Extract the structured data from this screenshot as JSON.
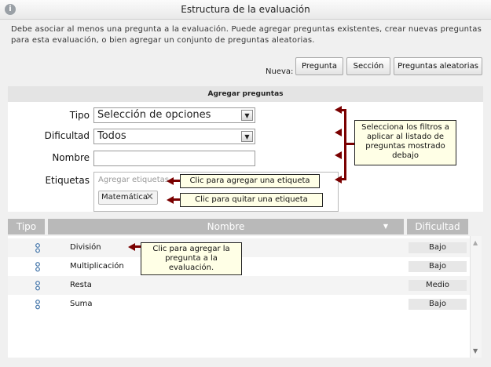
{
  "window": {
    "title": "Estructura de la evaluación",
    "info_icon": "info-icon"
  },
  "intro": "Debe asociar al menos una pregunta a la evaluación. Puede agregar preguntas existentes, crear nuevas preguntas para esta evaluación, o bien agregar un conjunto de preguntas aleatorias.",
  "toolbar": {
    "nueva_label": "Nueva:",
    "pregunta": "Pregunta",
    "seccion": "Sección",
    "aleatorias": "Preguntas aleatorias"
  },
  "panel": {
    "title": "Agregar preguntas",
    "tipo_label": "Tipo",
    "tipo_value": "Selección de opciones",
    "dificultad_label": "Dificultad",
    "dificultad_value": "Todos",
    "nombre_label": "Nombre",
    "nombre_value": "",
    "etiquetas_label": "Etiquetas",
    "etiquetas_placeholder": "Agregar etiquetas",
    "chip": "Matemática"
  },
  "callouts": {
    "filters": "Selecciona los filtros a aplicar al listado de preguntas mostrado debajo",
    "add_tag": "Clic para agregar una etiqueta",
    "remove_tag": "Clic para quitar una etiqueta",
    "add_question": "Clic para agregar la pregunta a la evaluación."
  },
  "table": {
    "headers": {
      "tipo": "Tipo",
      "nombre": "Nombre",
      "dificultad": "Dificultad"
    },
    "rows": [
      {
        "name": "División",
        "difficulty": "Bajo"
      },
      {
        "name": "Multiplicación",
        "difficulty": "Bajo"
      },
      {
        "name": "Resta",
        "difficulty": "Medio"
      },
      {
        "name": "Suma",
        "difficulty": "Bajo"
      }
    ]
  },
  "colors": {
    "accent_arrow": "#7a0000",
    "callout_bg": "#ffffe6",
    "header_gray": "#b9b9b9"
  }
}
